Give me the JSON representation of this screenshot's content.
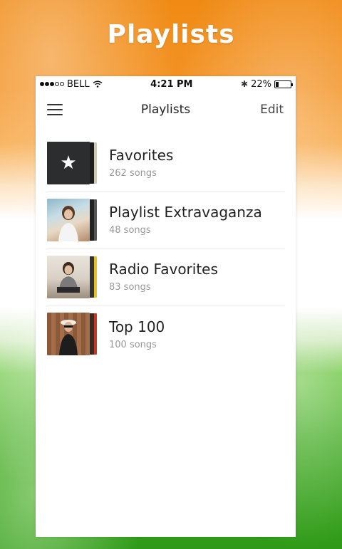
{
  "app_title": "Playlists",
  "status_bar": {
    "carrier": "BELL",
    "time": "4:21 PM",
    "battery_percent_label": "22%",
    "battery_level": 0.22,
    "signal_bars_filled": 3,
    "signal_bars_total": 5
  },
  "nav": {
    "menu_icon": "hamburger-menu-icon",
    "title": "Playlists",
    "edit_label": "Edit"
  },
  "playlists": [
    {
      "title": "Favorites",
      "count_label": "262 songs",
      "thumb": "star-icon",
      "accent": "#e6e0d0"
    },
    {
      "title": "Playlist Extravaganza",
      "count_label": "48 songs",
      "thumb": "photo",
      "accent": "#222222"
    },
    {
      "title": "Radio Favorites",
      "count_label": "83 songs",
      "thumb": "photo",
      "accent": "#e2c12a"
    },
    {
      "title": "Top 100",
      "count_label": "100 songs",
      "thumb": "photo",
      "accent": "#c0392b"
    }
  ],
  "colors": {
    "orange": "#f08a14",
    "green": "#3ea81e"
  }
}
